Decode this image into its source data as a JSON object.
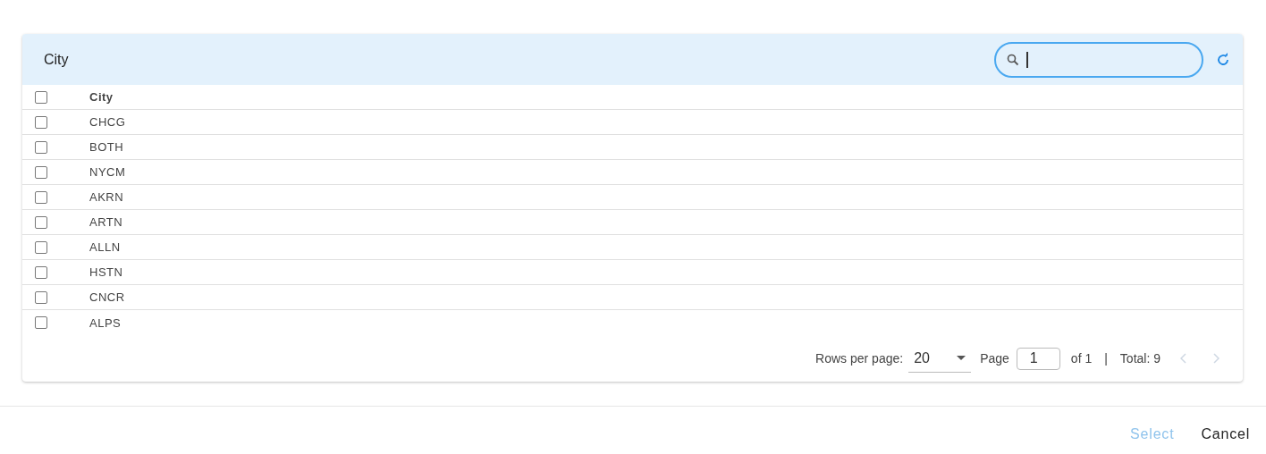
{
  "panel": {
    "title": "City",
    "search": {
      "focused": true
    }
  },
  "table": {
    "header_checked": false,
    "columns": [
      "City"
    ],
    "rows": [
      {
        "cells": [
          "CHCG"
        ],
        "checked": false
      },
      {
        "cells": [
          "BOTH"
        ],
        "checked": false
      },
      {
        "cells": [
          "NYCM"
        ],
        "checked": false
      },
      {
        "cells": [
          "AKRN"
        ],
        "checked": false
      },
      {
        "cells": [
          "ARTN"
        ],
        "checked": false
      },
      {
        "cells": [
          "ALLN"
        ],
        "checked": false
      },
      {
        "cells": [
          "HSTN"
        ],
        "checked": false
      },
      {
        "cells": [
          "CNCR"
        ],
        "checked": false
      },
      {
        "cells": [
          "ALPS"
        ],
        "checked": false
      }
    ]
  },
  "pagination": {
    "rows_label": "Rows per page:",
    "rows_value": "20",
    "page_label": "Page",
    "page_value": "1",
    "of_label": "of 1",
    "separator": "|",
    "total": "Total: 9",
    "prev_disabled": true,
    "next_disabled": true
  },
  "actions": [
    {
      "label": "Select",
      "disabled": true
    },
    {
      "label": "Cancel",
      "disabled": false
    }
  ]
}
